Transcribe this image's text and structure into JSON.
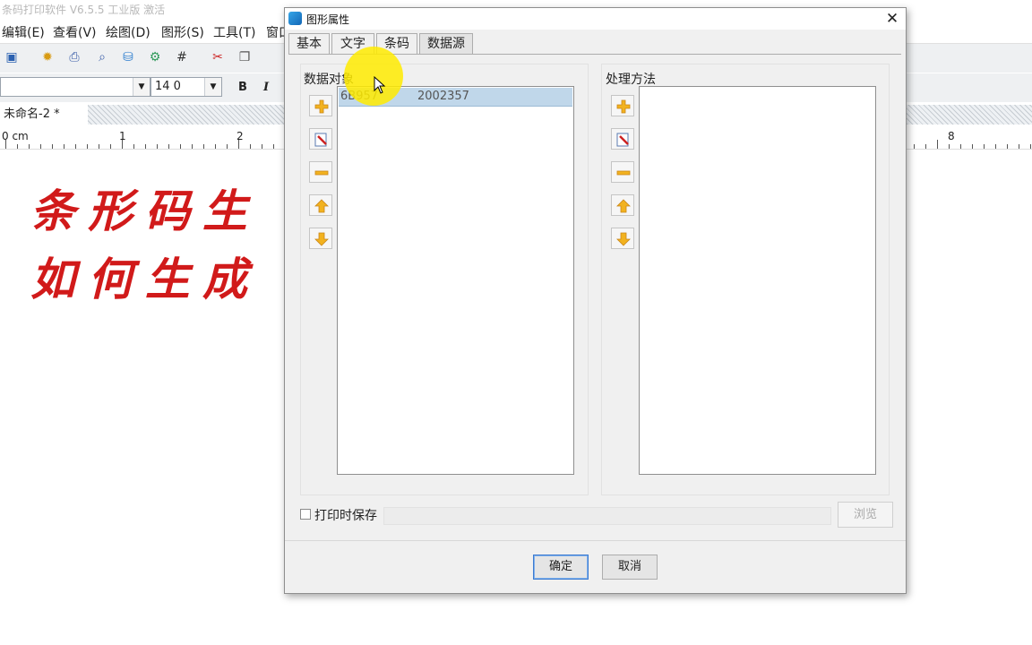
{
  "app": {
    "title": "条码打印软件 V6.5.5 工业版 激活",
    "menus": [
      "编辑(E)",
      "查看(V)",
      "绘图(D)",
      "图形(S)",
      "工具(T)",
      "窗口"
    ],
    "font_size_value": "14 0",
    "bold_label": "B",
    "italic_label": "I",
    "doc_tab": "未命名-2 *",
    "ruler_labels": [
      "0 cm",
      "1",
      "2",
      "8"
    ],
    "canvas_lines": [
      "条形码生",
      "如何生成"
    ]
  },
  "dialog": {
    "title": "图形属性",
    "close_glyph": "✕",
    "tabs": [
      "基本",
      "文字",
      "条码",
      "数据源"
    ],
    "active_tab": "数据源",
    "left_group": {
      "label": "数据对象",
      "items": [
        "6B957",
        "2002357"
      ]
    },
    "right_group": {
      "label": "处理方法"
    },
    "print_save_label": "打印时保存",
    "browse_label": "浏览",
    "ok_label": "确定",
    "cancel_label": "取消"
  },
  "colors": {
    "canvas_text": "#d11a1a",
    "highlight": "#ffeb00",
    "selected_item": "#c0d7ea",
    "icon_yellow": "#f2b21f"
  }
}
